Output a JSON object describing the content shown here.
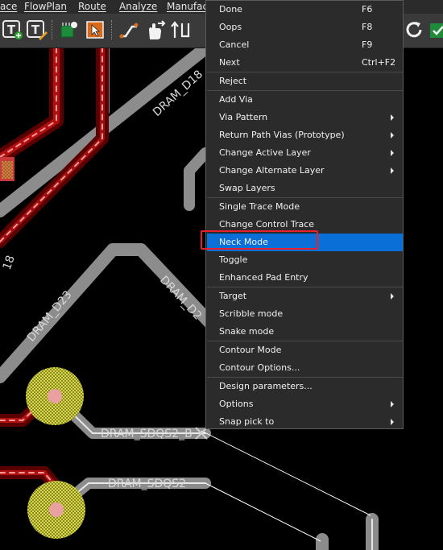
{
  "menubar": {
    "items": [
      {
        "label": "ace"
      },
      {
        "label": "FlowPlan"
      },
      {
        "label": "Route"
      },
      {
        "label": "Analyze"
      },
      {
        "label": "Manufac"
      }
    ]
  },
  "canvas": {
    "net_labels": [
      "DRAM_D18",
      "DRAM_D23",
      "DRAM_D2",
      "18",
      "DRAM_SDQS2_B",
      "DRAM_SDQS2"
    ]
  },
  "context_menu": {
    "items": [
      {
        "label": "Done",
        "shortcut": "F6"
      },
      {
        "label": "Oops",
        "shortcut": "F8"
      },
      {
        "label": "Cancel",
        "shortcut": "F9"
      },
      {
        "label": "Next",
        "shortcut": "Ctrl+F2"
      },
      {
        "label": "Reject"
      },
      {
        "label": "Add Via"
      },
      {
        "label": "Via Pattern",
        "submenu": true
      },
      {
        "label": "Return Path Vias (Prototype)",
        "submenu": true
      },
      {
        "label": "Change Active Layer",
        "submenu": true
      },
      {
        "label": "Change Alternate Layer",
        "submenu": true
      },
      {
        "label": "Swap Layers"
      },
      {
        "label": "Single Trace Mode"
      },
      {
        "label": "Change Control Trace"
      },
      {
        "label": "Neck Mode",
        "highlighted": true
      },
      {
        "label": "Toggle"
      },
      {
        "label": "Enhanced Pad Entry"
      },
      {
        "label": "Target",
        "submenu": true
      },
      {
        "label": "Scribble mode"
      },
      {
        "label": "Snake mode"
      },
      {
        "label": "Contour Mode"
      },
      {
        "label": "Contour Options..."
      },
      {
        "label": "Design parameters..."
      },
      {
        "label": "Options",
        "submenu": true
      },
      {
        "label": "Snap pick to",
        "submenu": true
      }
    ]
  },
  "colors": {
    "trace_dark_red": "#5a0000",
    "trace_red": "#b01010",
    "trace_gray": "#8c8c8c",
    "pad_yellow": "#d8d84a",
    "menu_highlight": "#0a70d8",
    "annotation_red": "#e8202a"
  }
}
